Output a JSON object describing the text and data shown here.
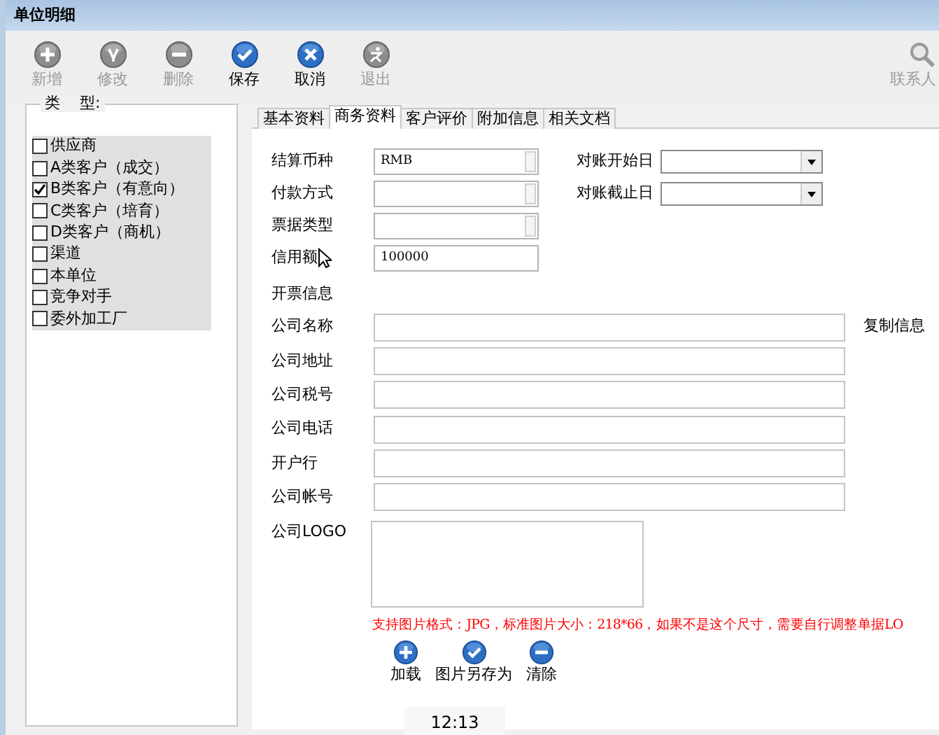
{
  "window": {
    "title": "单位明细"
  },
  "toolbar": [
    {
      "label": "新增",
      "kind": "add",
      "disabled": true
    },
    {
      "label": "修改",
      "kind": "edit",
      "disabled": true
    },
    {
      "label": "删除",
      "kind": "delete",
      "disabled": true
    },
    {
      "label": "保存",
      "kind": "save",
      "disabled": false
    },
    {
      "label": "取消",
      "kind": "cancel",
      "disabled": false
    },
    {
      "label": "退出",
      "kind": "exit",
      "disabled": true
    },
    {
      "label": "联系人",
      "kind": "search",
      "disabled": true
    }
  ],
  "type_group": {
    "title": "类    型:",
    "items": [
      {
        "label": "供应商",
        "checked": false
      },
      {
        "label": "A类客户（成交）",
        "checked": false
      },
      {
        "label": "B类客户（有意向）",
        "checked": true
      },
      {
        "label": "C类客户（培育）",
        "checked": false
      },
      {
        "label": "D类客户（商机）",
        "checked": false
      },
      {
        "label": "渠道",
        "checked": false
      },
      {
        "label": "本单位",
        "checked": false
      },
      {
        "label": "竞争对手",
        "checked": false
      },
      {
        "label": "委外加工厂",
        "checked": false
      }
    ]
  },
  "tabs": [
    {
      "label": "基本资料",
      "selected": false
    },
    {
      "label": "商务资料",
      "selected": true
    },
    {
      "label": "客户评价",
      "selected": false
    },
    {
      "label": "附加信息",
      "selected": false
    },
    {
      "label": "相关文档",
      "selected": false
    }
  ],
  "business": [
    {
      "label": "结算币种",
      "kind": "combo",
      "value": "RMB"
    },
    {
      "label": "付款方式",
      "kind": "combo"
    },
    {
      "label": "票据类型",
      "kind": "combo"
    },
    {
      "label": "信用额",
      "kind": "text",
      "value": "100000"
    }
  ],
  "reconcile": [
    {
      "label": "对账开始日"
    },
    {
      "label": "对账截止日"
    }
  ],
  "invoice": {
    "heading": "开票信息",
    "copy_link": "复制信息",
    "fields": [
      {
        "label": "公司名称"
      },
      {
        "label": "公司地址"
      },
      {
        "label": "公司税号"
      },
      {
        "label": "公司电话"
      },
      {
        "label": "开户行"
      },
      {
        "label": "公司帐号"
      }
    ]
  },
  "logo": {
    "label": "公司LOGO",
    "note": "支持图片格式：JPG，标准图片大小：218*66，如果不是这个尺寸，需要自行调整单据LO",
    "buttons": [
      {
        "label": "加载",
        "kind": "add"
      },
      {
        "label": "图片另存为",
        "kind": "save"
      },
      {
        "label": "清除",
        "kind": "delete"
      }
    ]
  },
  "clock": "12:13"
}
